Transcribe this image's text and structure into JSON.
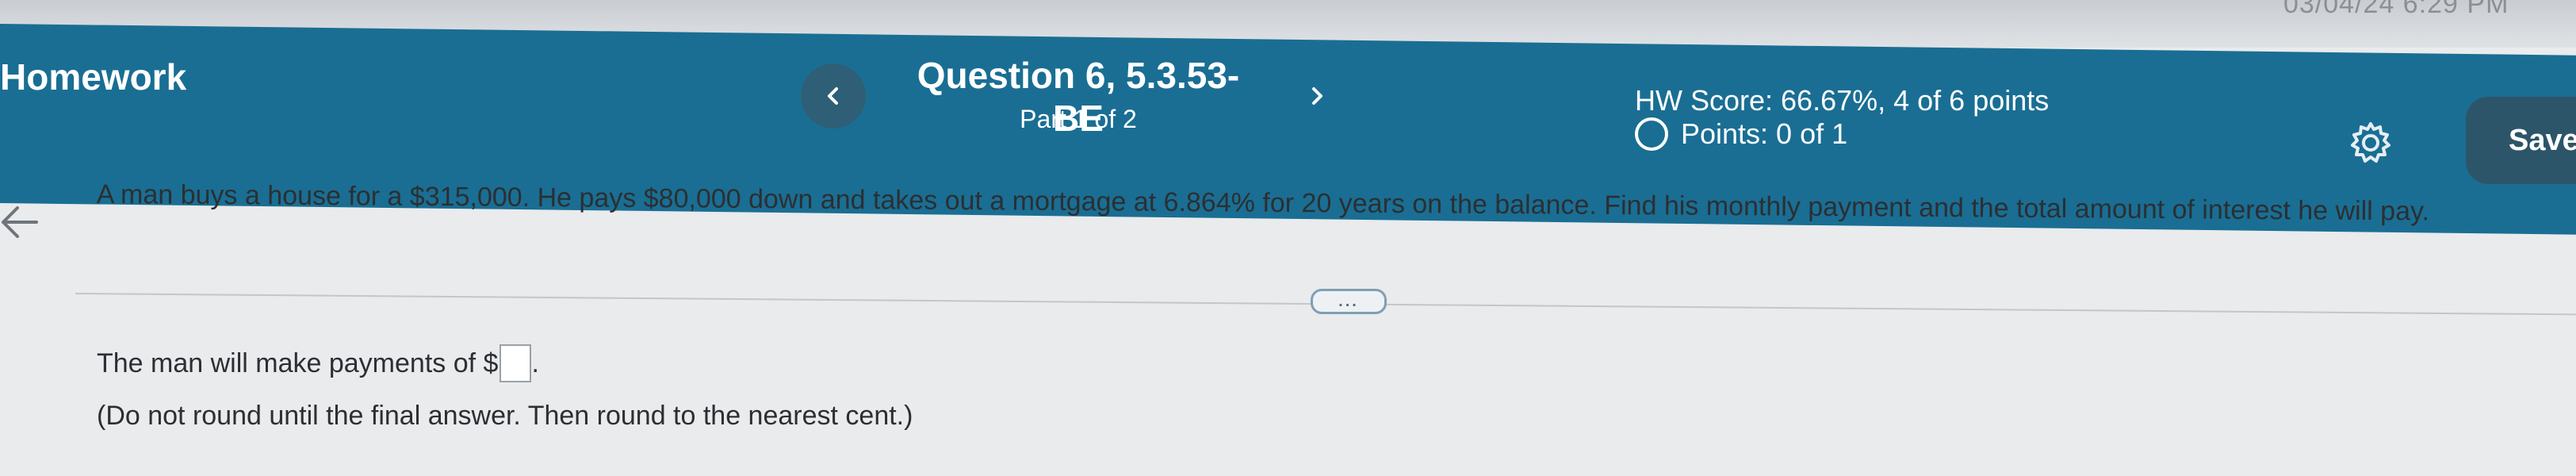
{
  "status_bar": {
    "clock": "03/04/24 6:29 PM"
  },
  "header": {
    "title": "Homework",
    "question_title": "Question 6, 5.3.53-BE",
    "part": "Part 1 of 2",
    "hw_score": "HW Score: 66.67%, 4 of 6 points",
    "points": "Points: 0 of 1",
    "save_label": "Save",
    "prev_symbol": "‹",
    "next_symbol": "›"
  },
  "question": {
    "text": "A man buys a house for a $315,000. He pays $80,000 down and takes out a mortgage at 6.864% for 20 years on the balance. Find his monthly payment and the total amount of interest he will pay.",
    "more_label": "..."
  },
  "answer": {
    "prompt": "The man will make payments of $",
    "suffix": ".",
    "note": "(Do not round until the final answer. Then round to the nearest cent.)"
  },
  "colors": {
    "header_bg": "#1a6e93",
    "save_bg": "#2c5569",
    "body_bg": "#e9ebed"
  }
}
